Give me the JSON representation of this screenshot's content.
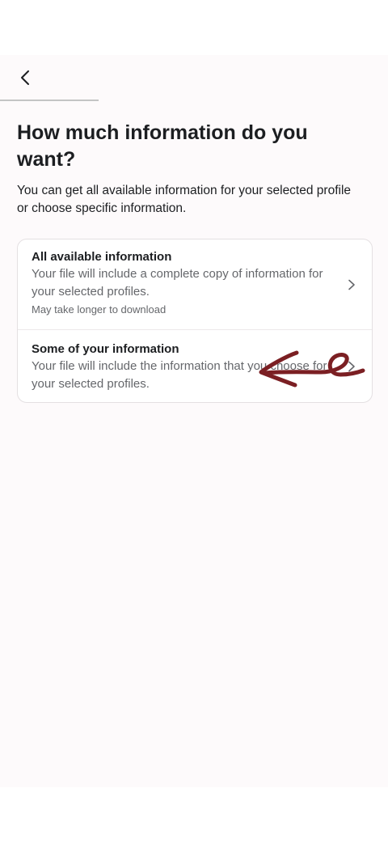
{
  "header": {
    "back_icon": "chevron-left-icon"
  },
  "page": {
    "title": "How much information do you want?",
    "subtitle": "You can get all available information for your selected profile or choose specific information."
  },
  "options": [
    {
      "title": "All available information",
      "description": "Your file will include a complete copy of information for your selected profiles.",
      "note": "May take longer to download",
      "icon": "chevron-right-icon"
    },
    {
      "title": "Some of your information",
      "description": "Your file will include the information that you choose for your selected profiles.",
      "icon": "chevron-right-icon"
    }
  ],
  "colors": {
    "background": "#fdfafb",
    "card": "#ffffff",
    "text_primary": "#1c1e21",
    "text_secondary": "#65676b",
    "annotation": "#7b1f23"
  }
}
